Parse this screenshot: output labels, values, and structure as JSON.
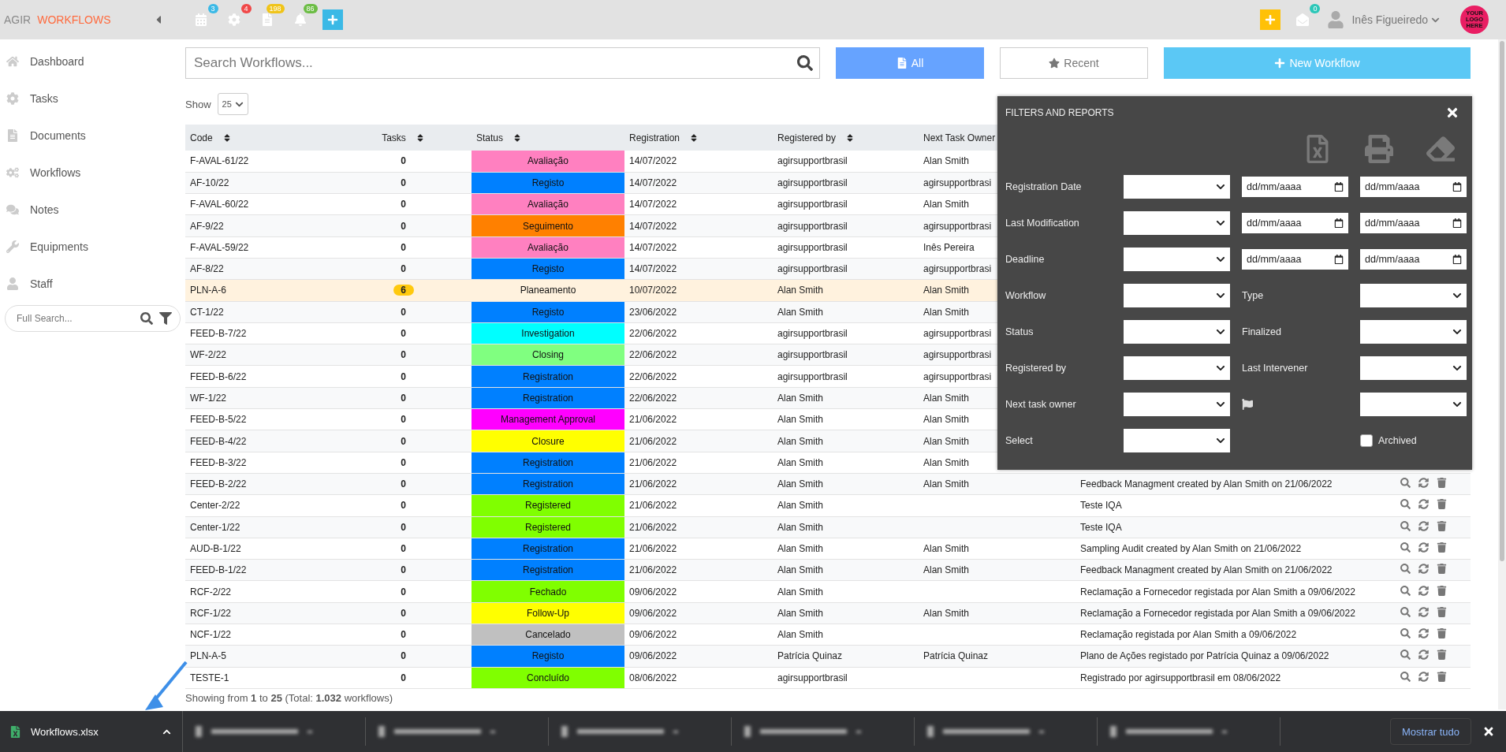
{
  "topbar": {
    "brand": "AGIR",
    "app": "WORKFLOWS",
    "shortcuts": [
      {
        "kind": "calendar",
        "count": "3",
        "color": "#3bb9e6"
      },
      {
        "kind": "gear",
        "count": "4",
        "color": "#f04848"
      },
      {
        "kind": "document",
        "count": "198",
        "color": "#f0c419"
      },
      {
        "kind": "bell",
        "count": "86",
        "color": "#6cbd45"
      },
      {
        "kind": "add"
      }
    ],
    "actions": [
      {
        "kind": "add"
      },
      {
        "kind": "messages",
        "count": "0",
        "color": "#2cc7b8"
      }
    ],
    "user": "Inês Figueiredo",
    "logo": [
      "YOUR",
      "LOGO",
      "HERE"
    ]
  },
  "sidebar": {
    "items": [
      {
        "label": "Dashboard"
      },
      {
        "label": "Tasks"
      },
      {
        "label": "Documents"
      },
      {
        "label": "Workflows"
      },
      {
        "label": "Notes"
      },
      {
        "label": "Equipments"
      },
      {
        "label": "Staff"
      }
    ],
    "search": {
      "placeholder": "Full Search..."
    }
  },
  "search": {
    "placeholder": "Search Workflows..."
  },
  "view_buttons": [
    {
      "label": "All",
      "selected": true
    },
    {
      "label": "Recent",
      "selected": false
    }
  ],
  "new_button": "New Workflow",
  "show": {
    "label": "Show",
    "value": "25"
  },
  "table": {
    "columns": [
      {
        "label": "Code",
        "sortable": true
      },
      {
        "label": "Tasks",
        "sortable": true
      },
      {
        "label": "Status",
        "sortable": true
      },
      {
        "label": "Registration",
        "sortable": true
      },
      {
        "label": "Registered by",
        "sortable": true
      },
      {
        "label": "Next Task Owner"
      }
    ],
    "rows": [
      {
        "code": "F-AVAL-61/22",
        "tasks": "0",
        "status": "Avaliação",
        "color": "#ff80c0",
        "date": "14/07/2022",
        "by": "agirsupportbrasil",
        "owner": "Alan Smith",
        "highlighted": false
      },
      {
        "code": "AF-10/22",
        "tasks": "0",
        "status": "Registo",
        "color": "#0080ff",
        "date": "14/07/2022",
        "by": "agirsupportbrasil",
        "owner": "agirsupportbrasi",
        "highlighted": false
      },
      {
        "code": "F-AVAL-60/22",
        "tasks": "0",
        "status": "Avaliação",
        "color": "#ff80c0",
        "date": "14/07/2022",
        "by": "agirsupportbrasil",
        "owner": "Alan Smith",
        "highlighted": false
      },
      {
        "code": "AF-9/22",
        "tasks": "0",
        "status": "Seguimento",
        "color": "#ff8000",
        "date": "14/07/2022",
        "by": "agirsupportbrasil",
        "owner": "agirsupportbrasi",
        "highlighted": false
      },
      {
        "code": "F-AVAL-59/22",
        "tasks": "0",
        "status": "Avaliação",
        "color": "#ff80c0",
        "date": "14/07/2022",
        "by": "agirsupportbrasil",
        "owner": "Inês Pereira",
        "highlighted": false
      },
      {
        "code": "AF-8/22",
        "tasks": "0",
        "status": "Registo",
        "color": "#0080ff",
        "date": "14/07/2022",
        "by": "agirsupportbrasil",
        "owner": "agirsupportbrasi",
        "highlighted": false
      },
      {
        "code": "PLN-A-6",
        "tasks": "6",
        "status": "Planeamento",
        "date": "10/07/2022",
        "by": "Alan Smith",
        "owner": "Alan Smith",
        "highlighted": true
      },
      {
        "code": "CT-1/22",
        "tasks": "0",
        "status": "Registo",
        "color": "#0080ff",
        "date": "23/06/2022",
        "by": "Alan Smith",
        "owner": "Alan Smith",
        "highlighted": false
      },
      {
        "code": "FEED-B-7/22",
        "tasks": "0",
        "status": "Investigation",
        "color": "#00ffff",
        "date": "22/06/2022",
        "by": "agirsupportbrasil",
        "owner": "agirsupportbrasi",
        "highlighted": false
      },
      {
        "code": "WF-2/22",
        "tasks": "0",
        "status": "Closing",
        "color": "#80ff80",
        "date": "22/06/2022",
        "by": "agirsupportbrasil",
        "owner": "agirsupportbrasi",
        "highlighted": false
      },
      {
        "code": "FEED-B-6/22",
        "tasks": "0",
        "status": "Registration",
        "color": "#0080ff",
        "date": "22/06/2022",
        "by": "agirsupportbrasil",
        "owner": "agirsupportbrasi",
        "highlighted": false
      },
      {
        "code": "WF-1/22",
        "tasks": "0",
        "status": "Registration",
        "color": "#0080ff",
        "date": "22/06/2022",
        "by": "Alan Smith",
        "owner": "Alan Smith",
        "highlighted": false
      },
      {
        "code": "FEED-B-5/22",
        "tasks": "0",
        "status": "Management Approval",
        "color": "#ff00ff",
        "date": "21/06/2022",
        "by": "Alan Smith",
        "owner": "Alan Smith",
        "highlighted": false
      },
      {
        "code": "FEED-B-4/22",
        "tasks": "0",
        "status": "Closure",
        "color": "#ffff00",
        "date": "21/06/2022",
        "by": "Alan Smith",
        "owner": "Alan Smith",
        "highlighted": false
      },
      {
        "code": "FEED-B-3/22",
        "tasks": "0",
        "status": "Registration",
        "color": "#0080ff",
        "date": "21/06/2022",
        "by": "Alan Smith",
        "owner": "Alan Smith",
        "highlighted": false
      },
      {
        "code": "FEED-B-2/22",
        "tasks": "0",
        "status": "Registration",
        "color": "#0080ff",
        "date": "21/06/2022",
        "by": "Alan Smith",
        "owner": "Alan Smith",
        "title": "Feedback Managment created by Alan Smith on 21/06/2022",
        "highlighted": false
      },
      {
        "code": "Center-2/22",
        "tasks": "0",
        "status": "Registered",
        "color": "#80ff00",
        "date": "21/06/2022",
        "by": "Alan Smith",
        "title": "Teste IQA",
        "highlighted": false
      },
      {
        "code": "Center-1/22",
        "tasks": "0",
        "status": "Registered",
        "color": "#80ff00",
        "date": "21/06/2022",
        "by": "Alan Smith",
        "title": "Teste IQA",
        "highlighted": false
      },
      {
        "code": "AUD-B-1/22",
        "tasks": "0",
        "status": "Registration",
        "color": "#0080ff",
        "date": "21/06/2022",
        "by": "Alan Smith",
        "owner": "Alan Smith",
        "title": "Sampling Audit created by Alan Smith on 21/06/2022",
        "highlighted": false
      },
      {
        "code": "FEED-B-1/22",
        "tasks": "0",
        "status": "Registration",
        "color": "#0080ff",
        "date": "21/06/2022",
        "by": "Alan Smith",
        "owner": "Alan Smith",
        "title": "Feedback Managment created by Alan Smith on 21/06/2022",
        "highlighted": false
      },
      {
        "code": "RCF-2/22",
        "tasks": "0",
        "status": "Fechado",
        "color": "#80ff00",
        "date": "09/06/2022",
        "by": "Alan Smith",
        "title": "Reclamação a Fornecedor registada por Alan Smith a 09/06/2022",
        "highlighted": false
      },
      {
        "code": "RCF-1/22",
        "tasks": "0",
        "status": "Follow-Up",
        "color": "#ffff00",
        "date": "09/06/2022",
        "by": "Alan Smith",
        "owner": "Alan Smith",
        "title": "Reclamação a Fornecedor registada por Alan Smith a 09/06/2022",
        "highlighted": false
      },
      {
        "code": "NCF-1/22",
        "tasks": "0",
        "status": "Cancelado",
        "color": "#c0c0c0",
        "date": "09/06/2022",
        "by": "Alan Smith",
        "title": "Reclamação registada por Alan Smith a 09/06/2022",
        "highlighted": false
      },
      {
        "code": "PLN-A-5",
        "tasks": "0",
        "status": "Registo",
        "color": "#0080ff",
        "date": "09/06/2022",
        "by": "Patrícia Quinaz",
        "owner": "Patrícia Quinaz",
        "title": "Plano de Ações registado por Patrícia Quinaz a 09/06/2022",
        "highlighted": false
      },
      {
        "code": "TESTE-1",
        "tasks": "0",
        "status": "Concluído",
        "color": "#80ff00",
        "date": "08/06/2022",
        "by": "agirsupportbrasil",
        "title": "Registrado por agirsupportbrasil em 08/06/2022",
        "highlighted": false
      }
    ]
  },
  "summary": "Showing from **1** to **25** (Total: **1.032** workflows)",
  "filters": {
    "title": "FILTERS AND REPORTS",
    "rows": [
      {
        "kind": "dates",
        "label": "Registration Date",
        "placeholders": [
          "dd/mm/aaaa",
          "dd/mm/aaaa"
        ]
      },
      {
        "kind": "dates",
        "label": "Last Modification",
        "placeholders": [
          "dd/mm/aaaa",
          "dd/mm/aaaa"
        ]
      },
      {
        "kind": "dates",
        "label": "Deadline",
        "placeholders": [
          "dd/mm/aaaa",
          "dd/mm/aaaa"
        ]
      },
      {
        "kind": "pair",
        "label": "Workflow",
        "second_label": "Type"
      },
      {
        "kind": "pair",
        "label": "Status",
        "second_label": "Finalized"
      },
      {
        "kind": "pair",
        "label": "Registered by",
        "second_label": "Last Intervener"
      },
      {
        "kind": "flag",
        "label": "Next task owner"
      },
      {
        "kind": "checkbox",
        "label": "Select",
        "checkbox_label": "Archived",
        "checked": false
      }
    ]
  },
  "downloads": {
    "file": "Workflows.xlsx",
    "show_all": "Mostrar tudo"
  }
}
